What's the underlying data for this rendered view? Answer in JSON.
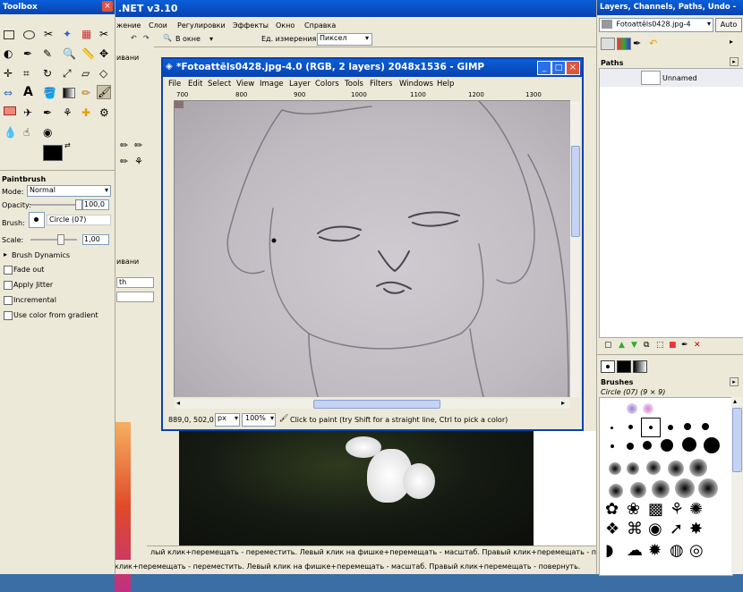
{
  "toolbox": {
    "title": "Toolbox",
    "fg_color": "#000000",
    "bg_color": "#ffffff",
    "paintbrush": {
      "title": "Paintbrush",
      "mode_label": "Mode:",
      "mode_value": "Normal",
      "opacity_label": "Opacity:",
      "opacity_value": "100,0",
      "brush_label": "Brush:",
      "brush_value": "Circle (07)",
      "scale_label": "Scale:",
      "scale_value": "1,00",
      "brush_dynamics": "Brush Dynamics",
      "fade_out": "Fade out",
      "apply_jitter": "Apply Jitter",
      "incremental": "Incremental",
      "use_color_gradient": "Use color from gradient"
    }
  },
  "paintnet": {
    "title": ".NET v3.10",
    "menu": [
      "жение",
      "Слои",
      "Регулировки",
      "Эффекты",
      "Окно",
      "Справка"
    ],
    "toolbar": {
      "window_value": "В окне",
      "units_label": "Ед. измерения:",
      "units_value": "Пиксел"
    },
    "left_label": "ивани",
    "left_label2": "ивани",
    "fragment_label": "th",
    "status": "клик+перемещать - переместить. Левый клик на фишке+перемещать - масштаб. Правый клик+перемещать - повернуть.",
    "status2": "лый клик+перемещать - переместить. Левый клик на фишке+перемещать - масштаб. Правый клик+перемещать - повернуть."
  },
  "gimp_window": {
    "title": "*Fotoattēls0428.jpg-4.0 (RGB, 2 layers) 2048x1536 - GIMP",
    "menu": [
      "File",
      "Edit",
      "Select",
      "View",
      "Image",
      "Layer",
      "Colors",
      "Tools",
      "Filters",
      "Windows",
      "Help"
    ],
    "ruler_ticks": [
      "700",
      "800",
      "900",
      "1000",
      "1100",
      "1200",
      "1300"
    ],
    "coords": "889,0, 502,0",
    "unit": "px",
    "zoom": "100%",
    "status": "Click to paint (try Shift for a straight line, Ctrl to pick a color)"
  },
  "layers": {
    "title": "Layers, Channels, Paths, Undo - ",
    "image_select": "Fotoattēls0428.jpg-4",
    "auto_label": "Auto",
    "paths_title": "Paths",
    "path_name": "Unnamed",
    "brushes_title": "Brushes",
    "brush_current": "Circle (07) (9 × 9)"
  }
}
